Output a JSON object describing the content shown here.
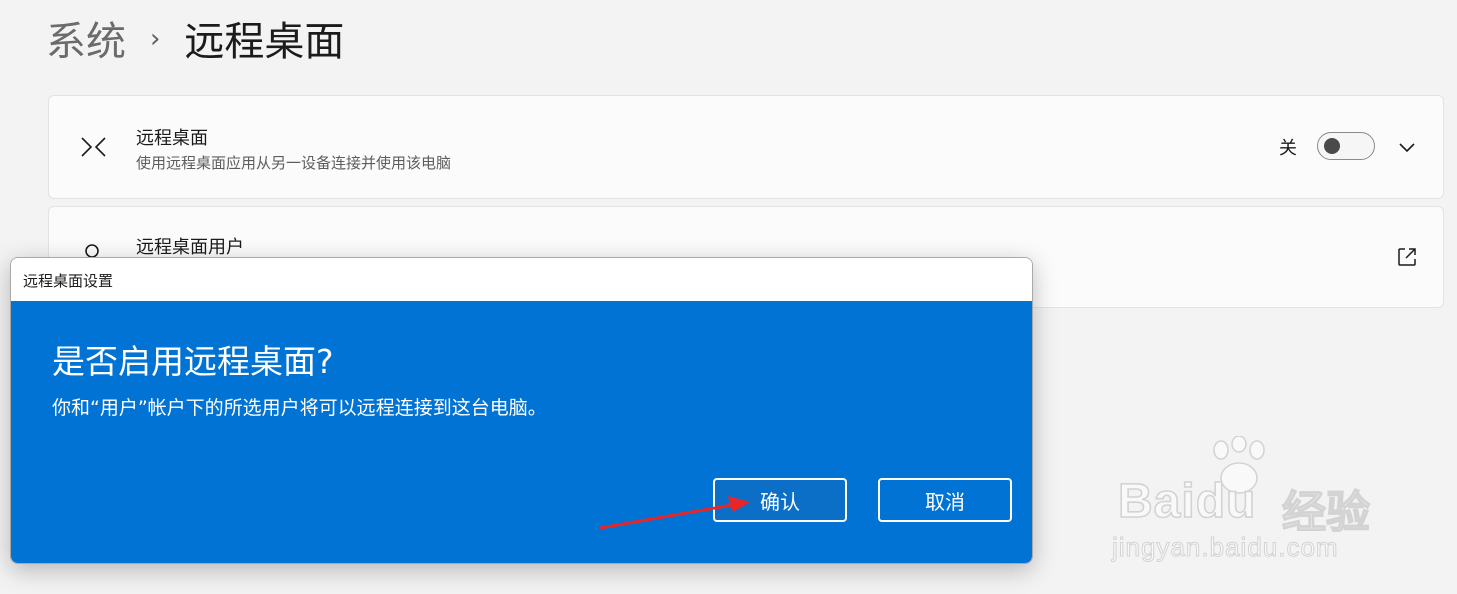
{
  "breadcrumb": {
    "parent": "系统",
    "separator": "›",
    "current": "远程桌面"
  },
  "cards": {
    "remote_desktop": {
      "icon": "remote-desktop-icon",
      "title": "远程桌面",
      "subtitle": "使用远程桌面应用从另一设备连接并使用该电脑",
      "toggle_state_label": "关",
      "toggle_on": false
    },
    "remote_users": {
      "icon": "user-icon",
      "title": "远程桌面用户",
      "trailing_icon": "external-link-icon"
    }
  },
  "dialog": {
    "window_title": "远程桌面设置",
    "heading": "是否启用远程桌面?",
    "message": "你和“用户”帐户下的所选用户将可以远程连接到这台电脑。",
    "confirm_label": "确认",
    "cancel_label": "取消",
    "background_color": "#0173d4"
  },
  "watermark": {
    "logo": "Baidu",
    "chinese": "经验",
    "url": "jingyan.baidu.com"
  }
}
